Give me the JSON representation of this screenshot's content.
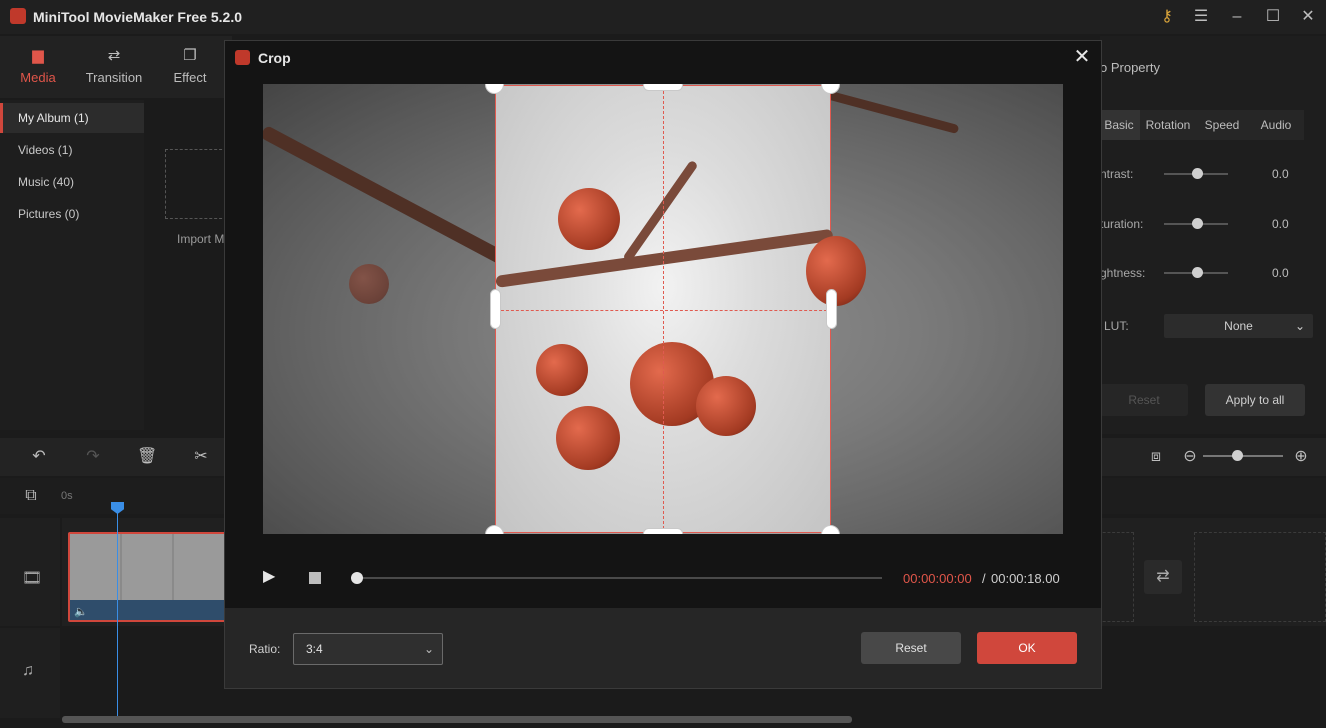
{
  "app": {
    "title": "MiniTool MovieMaker Free 5.2.0"
  },
  "top_tabs": [
    {
      "label": "Media",
      "icon": "folder-icon"
    },
    {
      "label": "Transition",
      "icon": "transition-icon"
    },
    {
      "label": "Effect",
      "icon": "effect-icon"
    }
  ],
  "media_nav": [
    {
      "label": "My Album (1)"
    },
    {
      "label": "Videos (1)"
    },
    {
      "label": "Music (40)"
    },
    {
      "label": "Pictures (0)"
    }
  ],
  "import_label": "Import M",
  "properties": {
    "title": "o Property",
    "tabs": [
      "Basic",
      "Rotation",
      "Speed",
      "Audio"
    ],
    "sliders": [
      {
        "label": "ntrast:",
        "value": "0.0"
      },
      {
        "label": "turation:",
        "value": "0.0"
      },
      {
        "label": "ghtness:",
        "value": "0.0"
      }
    ],
    "lut_label": "LUT:",
    "lut_value": "None",
    "reset_label": "Reset",
    "apply_all_label": "Apply to all"
  },
  "timeline": {
    "zero_label": "0s"
  },
  "crop": {
    "title": "Crop",
    "time_current": "00:00:00:00",
    "time_separator": "/",
    "time_total": "00:00:18.00",
    "ratio_label": "Ratio:",
    "ratio_value": "3:4",
    "reset_label": "Reset",
    "ok_label": "OK"
  },
  "colors": {
    "accent": "#d0473c",
    "time_current": "#e0564a",
    "playhead": "#3a8ee6"
  }
}
